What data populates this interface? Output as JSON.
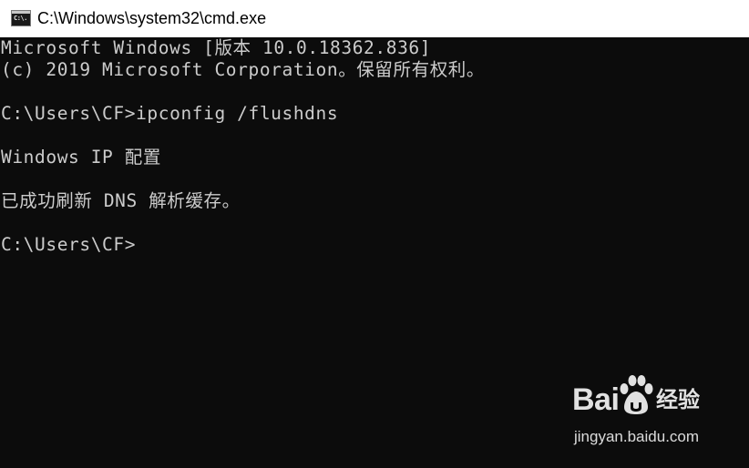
{
  "window": {
    "title": "C:\\Windows\\system32\\cmd.exe",
    "icon": "cmd-console-icon",
    "icon_text": "C:\\."
  },
  "console": {
    "colors": {
      "background": "#0c0c0c",
      "text": "#cccccc"
    },
    "lines": [
      "Microsoft Windows [版本 10.0.18362.836]",
      "(c) 2019 Microsoft Corporation。保留所有权利。",
      "",
      "C:\\Users\\CF>ipconfig /flushdns",
      "",
      "Windows IP 配置",
      "",
      "已成功刷新 DNS 解析缓存。",
      "",
      "C:\\Users\\CF>"
    ]
  },
  "watermark": {
    "logo_text_left": "Bai",
    "logo_text_right": "经验",
    "url": "jingyan.baidu.com"
  }
}
